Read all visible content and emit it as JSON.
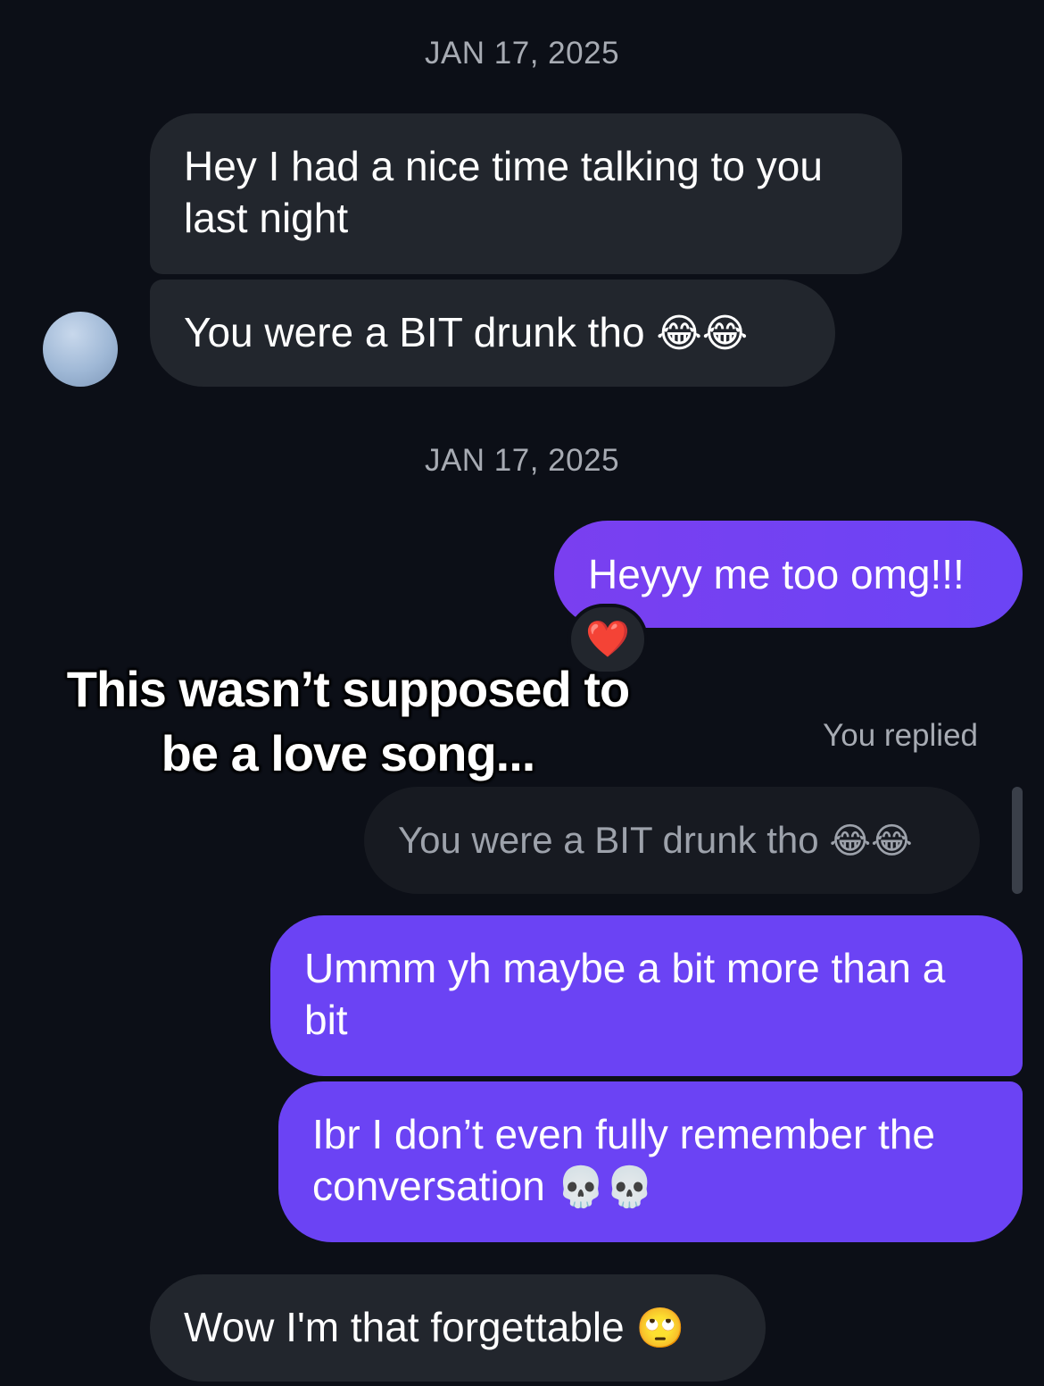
{
  "thread": {
    "date_1": "JAN 17, 2025",
    "date_2": "JAN 17, 2025",
    "messages": [
      {
        "from": "them",
        "text": "Hey I had a nice time talking to you last night"
      },
      {
        "from": "them",
        "text": "You were a BIT drunk tho",
        "emoji": "😂😂"
      },
      {
        "from": "me",
        "text": "Heyyy me too omg!!!",
        "reaction": "❤️"
      },
      {
        "from": "me",
        "text": "Ummm yh maybe a bit more than a bit"
      },
      {
        "from": "me",
        "text": "Ibr I don’t even fully remember the conversation",
        "emoji": "💀💀"
      },
      {
        "from": "them",
        "text": "Wow I'm that forgettable",
        "emoji": "🙄"
      }
    ],
    "reply_label": "You replied",
    "quoted": {
      "text": "You were a BIT drunk tho",
      "emoji": "😂😂"
    }
  },
  "overlay_caption": {
    "line1": "This wasn’t supposed to",
    "line2": "be a love song..."
  },
  "colors": {
    "background": "#0c0f17",
    "received_bubble": "#22262d",
    "sent_bubble": "#6b44f5",
    "timestamp": "#a7abb3"
  }
}
